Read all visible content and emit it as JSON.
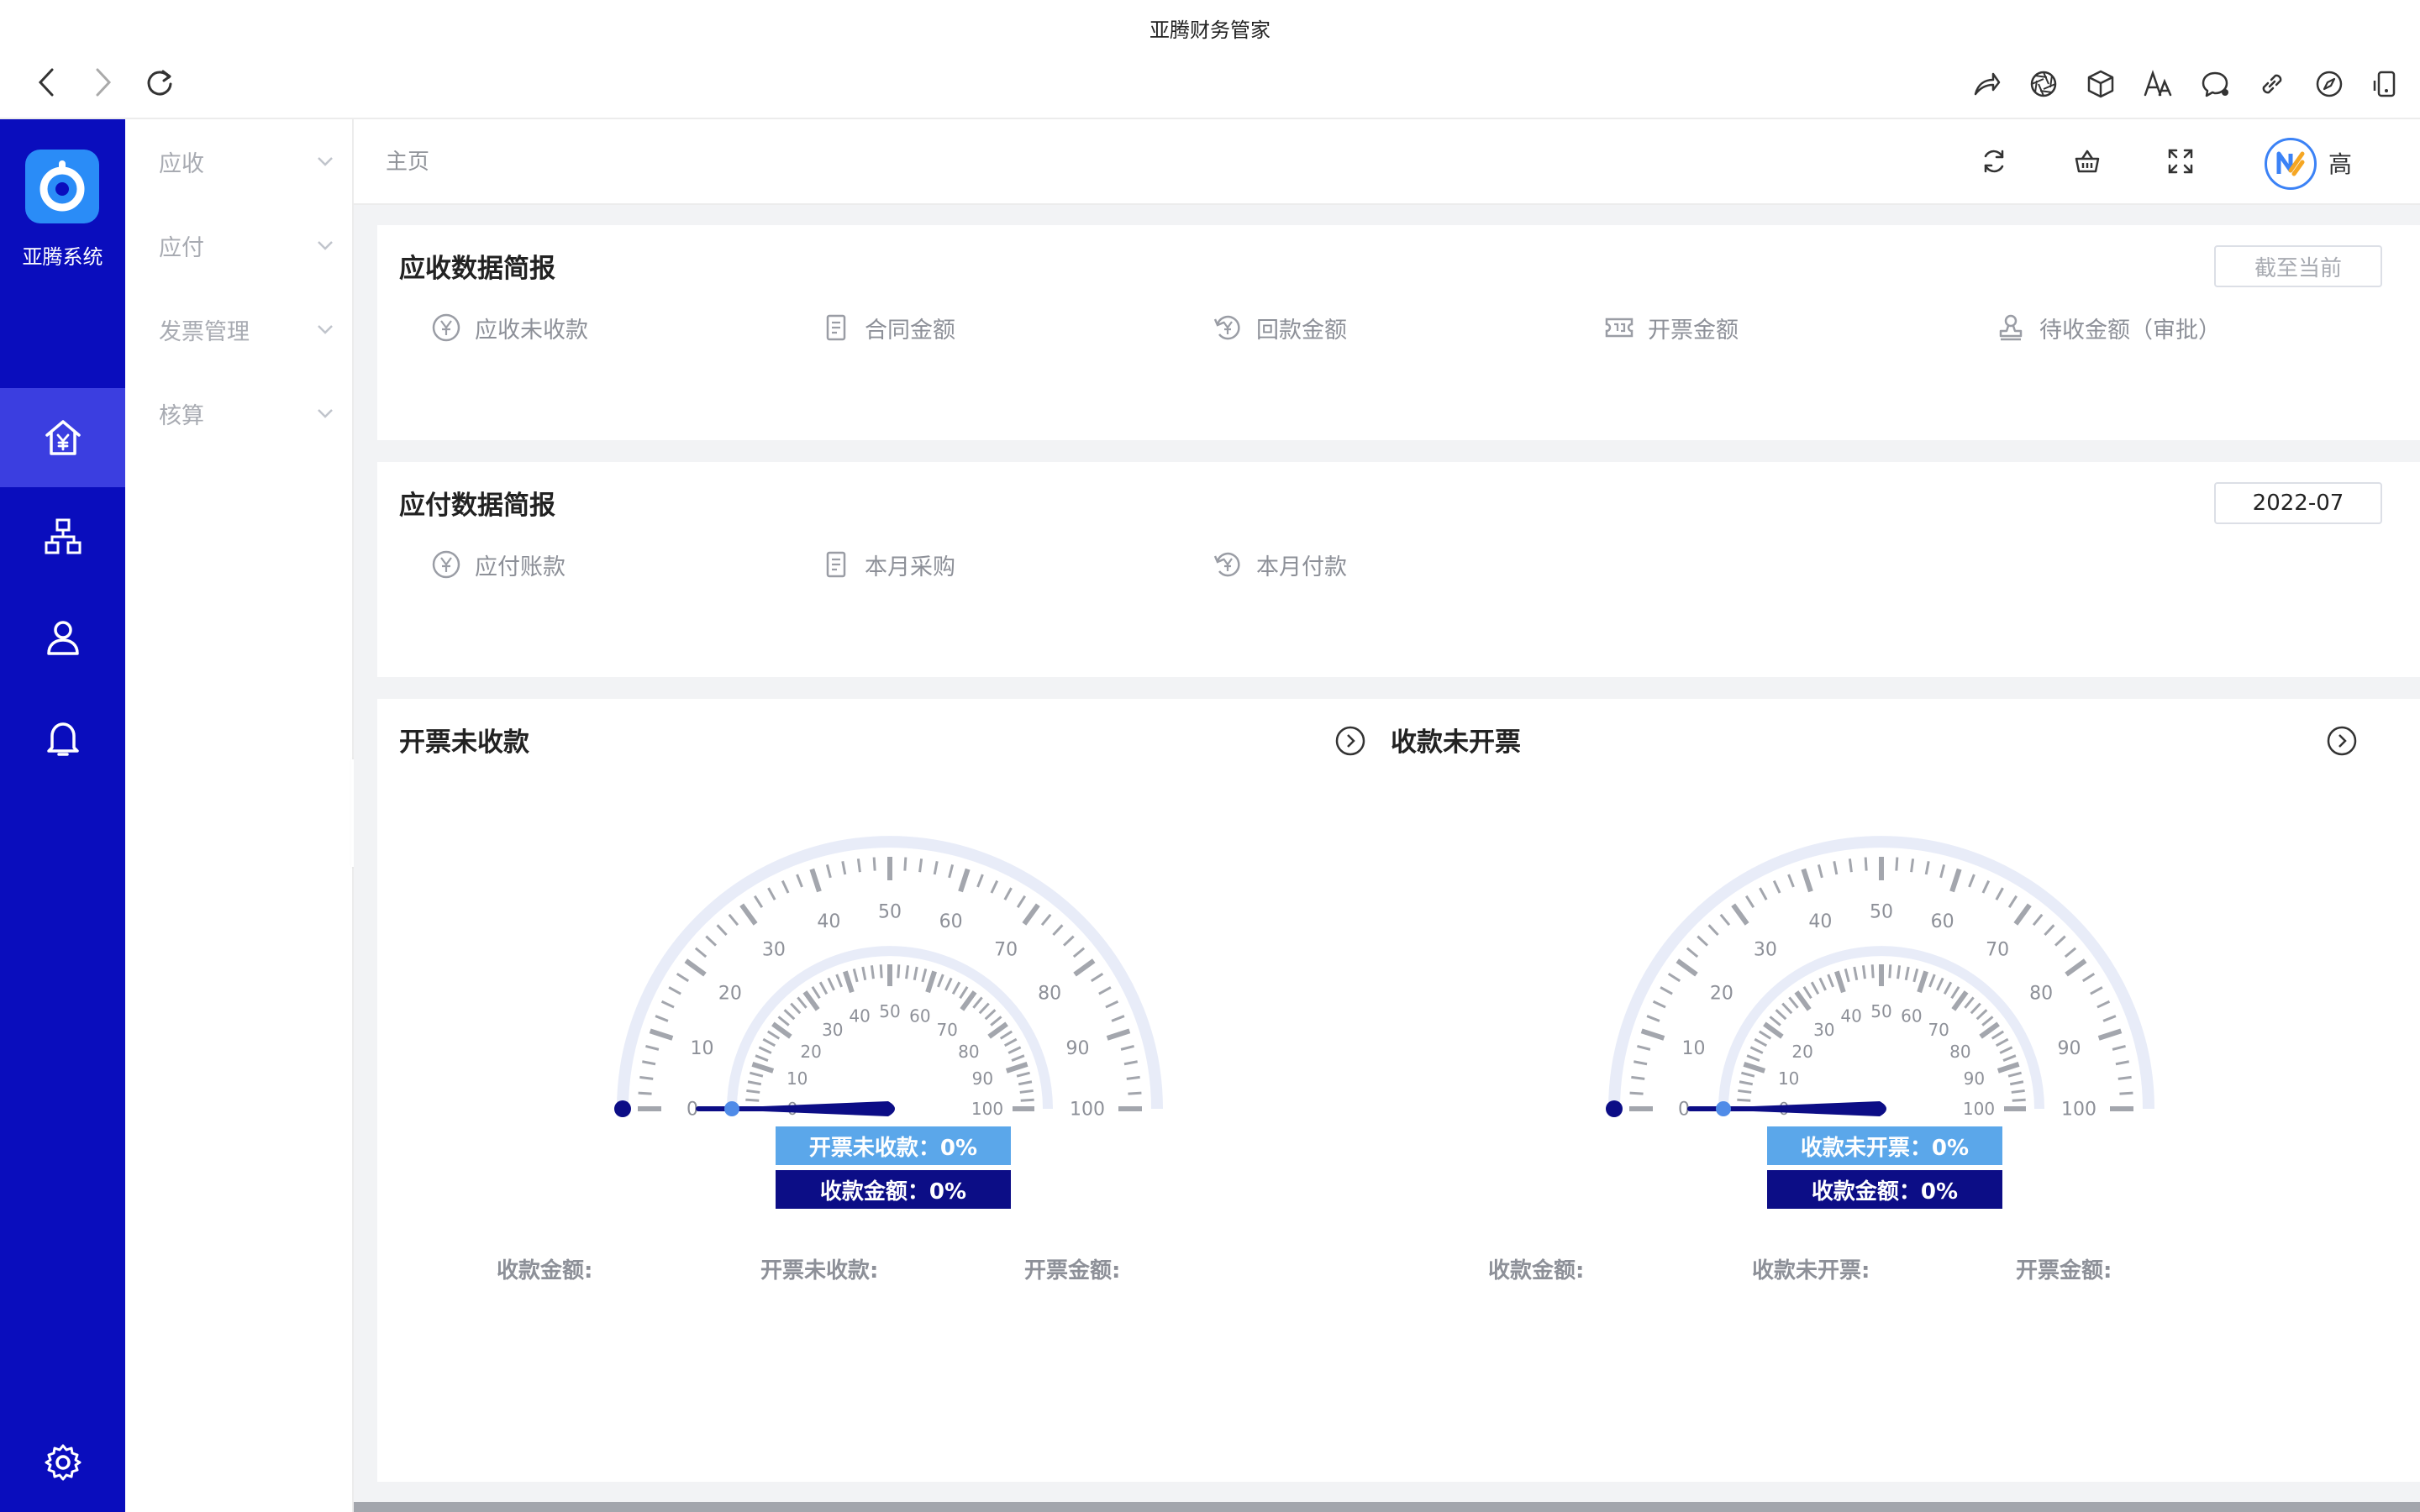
{
  "window": {
    "title": "亚腾财务管家"
  },
  "brand": {
    "name": "亚腾系统",
    "color": "#0a0dbd",
    "accent": "#3b3ee0"
  },
  "rail": {
    "items": [
      {
        "icon": "home-icon"
      },
      {
        "icon": "finance-home-icon",
        "active": true
      },
      {
        "icon": "org-chart-icon"
      },
      {
        "icon": "user-icon"
      },
      {
        "icon": "bell-icon"
      }
    ],
    "settings_icon": "gear-icon"
  },
  "submenu": {
    "items": [
      {
        "label": "应收"
      },
      {
        "label": "应付"
      },
      {
        "label": "发票管理"
      },
      {
        "label": "核算"
      }
    ]
  },
  "header": {
    "breadcrumb": "主页",
    "user_initial": "高"
  },
  "receivable": {
    "title": "应收数据简报",
    "date_placeholder": "截至当前",
    "stats": [
      {
        "label": "应收未收款",
        "icon": "yen-circle-icon"
      },
      {
        "label": "合同金额",
        "icon": "document-icon"
      },
      {
        "label": "回款金额",
        "icon": "refund-icon"
      },
      {
        "label": "开票金额",
        "icon": "ticket-icon"
      },
      {
        "label": "待收金额（审批）",
        "icon": "stamp-icon"
      }
    ]
  },
  "payable": {
    "title": "应付数据简报",
    "date_value": "2022-07",
    "stats": [
      {
        "label": "应付账款",
        "icon": "yen-circle-icon"
      },
      {
        "label": "本月采购",
        "icon": "document-icon"
      },
      {
        "label": "本月付款",
        "icon": "refund-icon"
      }
    ]
  },
  "gauges": [
    {
      "title": "开票未收款",
      "tag1": "开票未收款：0%",
      "tag2": "收款金额：0%",
      "value_outer": 0,
      "value_inner": 0,
      "ticks": [
        "0",
        "10",
        "20",
        "30",
        "40",
        "50",
        "60",
        "70",
        "80",
        "90",
        "100"
      ],
      "footer": [
        "收款金额:",
        "开票未收款:",
        "开票金额:"
      ]
    },
    {
      "title": "收款未开票",
      "tag1": "收款未开票：0%",
      "tag2": "收款金额：0%",
      "value_outer": 0,
      "value_inner": 0,
      "ticks": [
        "0",
        "10",
        "20",
        "30",
        "40",
        "50",
        "60",
        "70",
        "80",
        "90",
        "100"
      ],
      "footer": [
        "收款金额:",
        "收款未开票:",
        "开票金额:"
      ]
    }
  ]
}
